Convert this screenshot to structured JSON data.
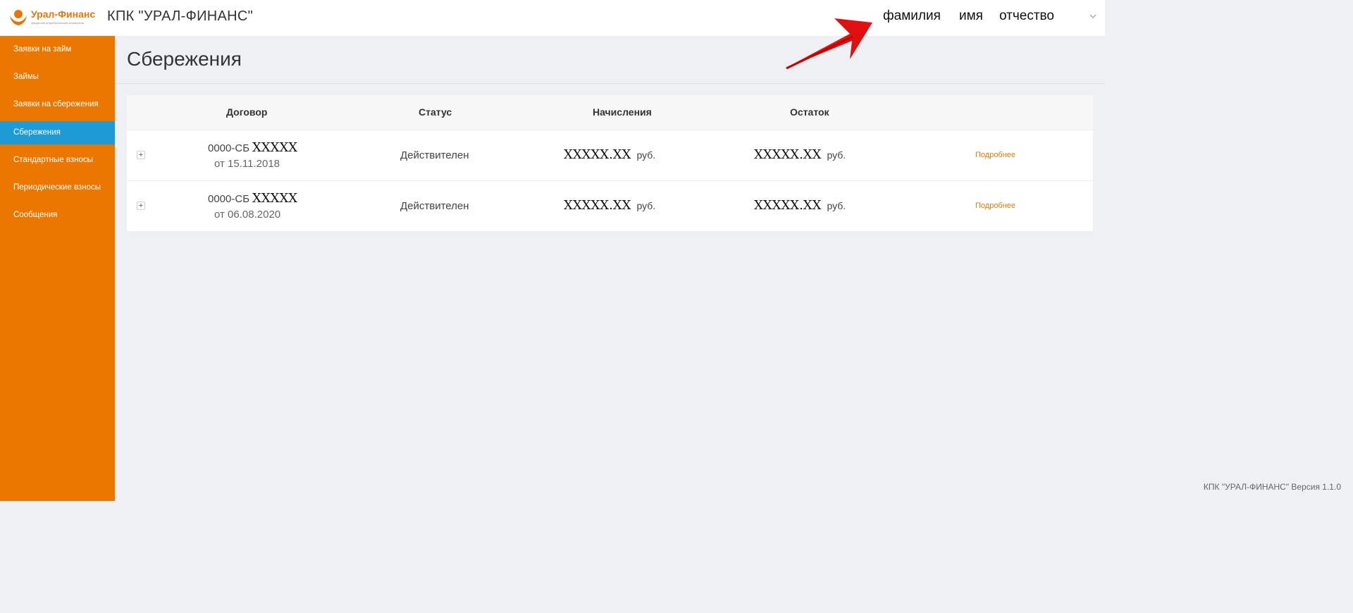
{
  "header": {
    "logo_text": "Урал-Финанс",
    "logo_subtext": "кредитный потребительский кооператив",
    "app_title": "КПК \"УРАЛ-ФИНАНС\"",
    "user": {
      "last_name": "фамилия",
      "first_name": "имя",
      "patronymic": "отчество"
    },
    "chevron_icon": "chevron-down-icon",
    "annotation_color": "#e01010"
  },
  "sidebar": {
    "background": "#ec7700",
    "active_color": "#1e9bd7",
    "items": [
      {
        "label": "Заявки на займ"
      },
      {
        "label": "Займы"
      },
      {
        "label": "Заявки на сбережения"
      },
      {
        "label": "Сбережения",
        "active": true
      },
      {
        "label": "Стандартные взносы"
      },
      {
        "label": "Периодические взносы"
      },
      {
        "label": "Сообщения"
      }
    ]
  },
  "main": {
    "title": "Сбережения",
    "table": {
      "columns": [
        "Договор",
        "Статус",
        "Начисления",
        "Остаток"
      ],
      "rows": [
        {
          "contract_prefix": "0000-СБ",
          "contract_mask": "XXXXX",
          "date": "от 15.11.2018",
          "status": "Действителен",
          "accrual": "XXXXX.XX",
          "accrual_unit": "руб.",
          "balance": "XXXXX.XX",
          "balance_unit": "руб.",
          "more": "Подробнее"
        },
        {
          "contract_prefix": "0000-СБ",
          "contract_mask": "XXXXX",
          "date": "от 06.08.2020",
          "status": "Действителен",
          "accrual": "XXXXX.XX",
          "accrual_unit": "руб.",
          "balance": "XXXXX.XX",
          "balance_unit": "руб.",
          "more": "Подробнее"
        }
      ]
    }
  },
  "footer": {
    "text": "КПК \"УРАЛ-ФИНАНС\" Версия 1.1.0"
  }
}
